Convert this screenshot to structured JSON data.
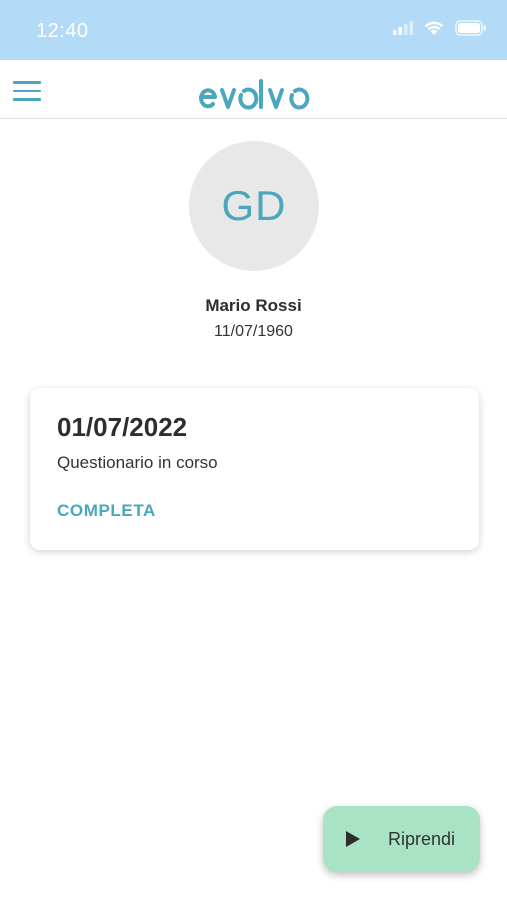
{
  "status_bar": {
    "time": "12:40"
  },
  "header": {
    "logo_text": "evolvo",
    "brand_color": "#4aa7bd"
  },
  "profile": {
    "initials": "GD",
    "name": "Mario Rossi",
    "birth_date": "11/07/1960"
  },
  "card": {
    "date": "01/07/2022",
    "status": "Questionario in corso",
    "action_label": "COMPLETA"
  },
  "fab": {
    "label": "Riprendi",
    "icon": "play-icon",
    "color": "#a9e3c5"
  }
}
